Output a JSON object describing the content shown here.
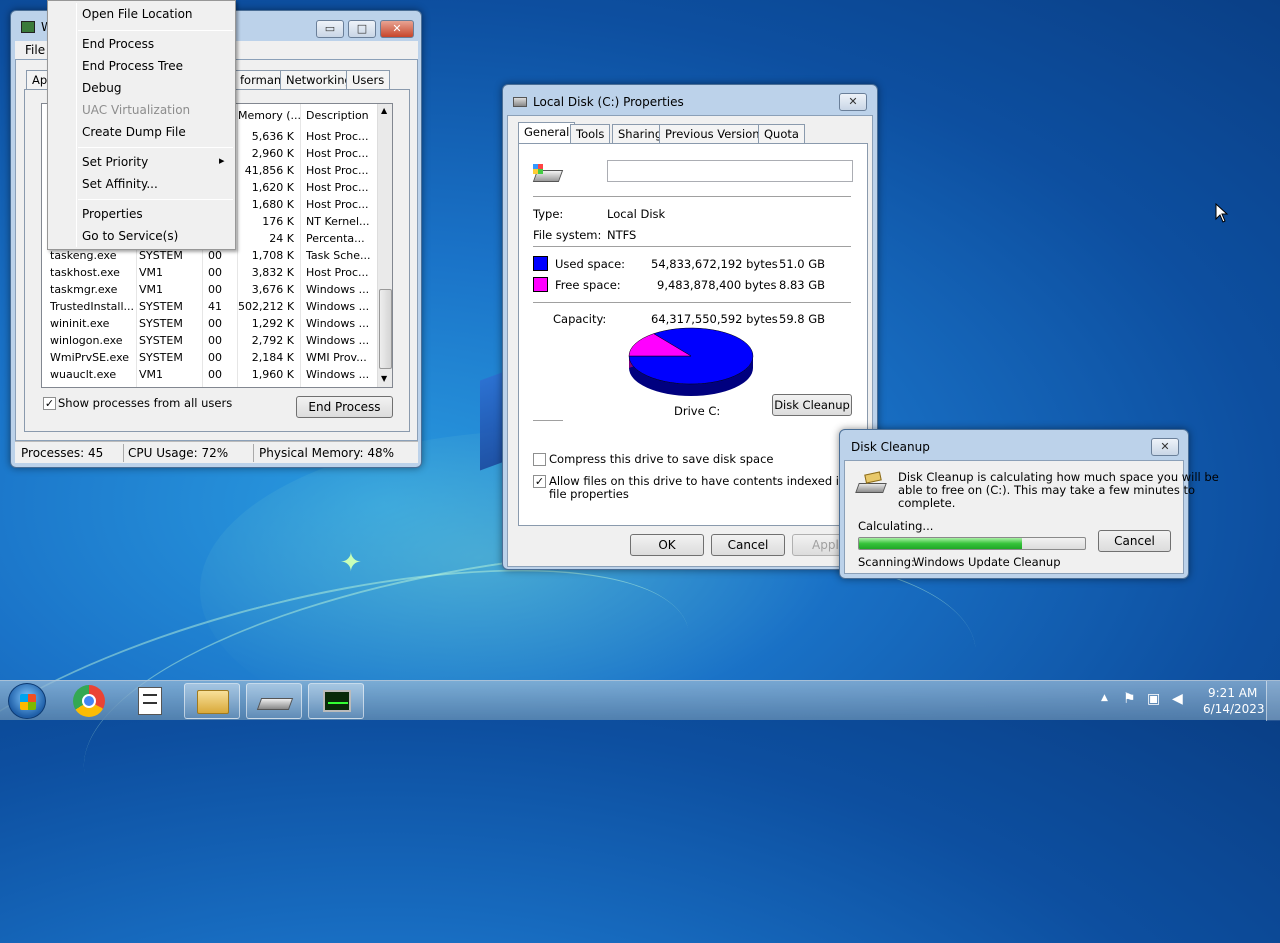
{
  "taskmgr": {
    "title": "W",
    "menu_file": "File",
    "tabs": [
      "App",
      "formance",
      "Networking",
      "Users"
    ],
    "columns": {
      "memory": "Memory (...",
      "description": "Description"
    },
    "rows": [
      {
        "name": "",
        "user": "",
        "cpu": "",
        "mem": "5,636 K",
        "desc": "Host Proc..."
      },
      {
        "name": "",
        "user": "",
        "cpu": "",
        "mem": "2,960 K",
        "desc": "Host Proc..."
      },
      {
        "name": "",
        "user": "",
        "cpu": "",
        "mem": "41,856 K",
        "desc": "Host Proc..."
      },
      {
        "name": "",
        "user": "",
        "cpu": "",
        "mem": "1,620 K",
        "desc": "Host Proc..."
      },
      {
        "name": "",
        "user": "",
        "cpu": "",
        "mem": "1,680 K",
        "desc": "Host Proc..."
      },
      {
        "name": "",
        "user": "",
        "cpu": "",
        "mem": "176 K",
        "desc": "NT Kernel..."
      },
      {
        "name": "",
        "user": "",
        "cpu": "",
        "mem": "24 K",
        "desc": "Percenta..."
      },
      {
        "name": "taskeng.exe",
        "user": "SYSTEM",
        "cpu": "00",
        "mem": "1,708 K",
        "desc": "Task Sche..."
      },
      {
        "name": "taskhost.exe",
        "user": "VM1",
        "cpu": "00",
        "mem": "3,832 K",
        "desc": "Host Proc..."
      },
      {
        "name": "taskmgr.exe",
        "user": "VM1",
        "cpu": "00",
        "mem": "3,676 K",
        "desc": "Windows ..."
      },
      {
        "name": "TrustedInstall...",
        "user": "SYSTEM",
        "cpu": "41",
        "mem": "502,212 K",
        "desc": "Windows ..."
      },
      {
        "name": "wininit.exe",
        "user": "SYSTEM",
        "cpu": "00",
        "mem": "1,292 K",
        "desc": "Windows ..."
      },
      {
        "name": "winlogon.exe",
        "user": "SYSTEM",
        "cpu": "00",
        "mem": "2,792 K",
        "desc": "Windows ..."
      },
      {
        "name": "WmiPrvSE.exe",
        "user": "SYSTEM",
        "cpu": "00",
        "mem": "2,184 K",
        "desc": "WMI Prov..."
      },
      {
        "name": "wuauclt.exe",
        "user": "VM1",
        "cpu": "00",
        "mem": "1,960 K",
        "desc": "Windows ..."
      }
    ],
    "show_all_label": "Show processes from all users",
    "show_all_checked": "✓",
    "end_process": "End Process",
    "status": {
      "processes": "Processes: 45",
      "cpu": "CPU Usage: 72%",
      "memory": "Physical Memory: 48%"
    }
  },
  "context_menu": {
    "open_location": "Open File Location",
    "end_process": "End Process",
    "end_tree": "End Process Tree",
    "debug": "Debug",
    "uac": "UAC Virtualization",
    "dump": "Create Dump File",
    "priority": "Set Priority",
    "affinity": "Set Affinity...",
    "properties": "Properties",
    "services": "Go to Service(s)",
    "submenu_arrow": "▸"
  },
  "props": {
    "title": "Local Disk (C:) Properties",
    "tabs": [
      "General",
      "Tools",
      "Sharing",
      "Previous Versions",
      "Quota"
    ],
    "name_value": "",
    "type_label": "Type:",
    "type_value": "Local Disk",
    "fs_label": "File system:",
    "fs_value": "NTFS",
    "used_label": "Used space:",
    "used_bytes": "54,833,672,192 bytes",
    "used_gb": "51.0 GB",
    "free_label": "Free space:",
    "free_bytes": "9,483,878,400 bytes",
    "free_gb": "8.83 GB",
    "cap_label": "Capacity:",
    "cap_bytes": "64,317,550,592 bytes",
    "cap_gb": "59.8 GB",
    "drive_label": "Drive C:",
    "cleanup_button": "Disk Cleanup",
    "compress_label": "Compress this drive to save disk space",
    "index_label_1": "Allow files on this drive to have contents indexed in addition to",
    "index_label_2": "file properties",
    "index_checked": "✓",
    "ok": "OK",
    "cancel": "Cancel",
    "apply": "Apply",
    "used_color": "#0000ff",
    "free_color": "#ff00ff",
    "used_fraction": 0.853
  },
  "cleanup": {
    "title": "Disk Cleanup",
    "message_1": "Disk Cleanup is calculating how much space you will be",
    "message_2": "able to free on  (C:). This may take a few minutes to",
    "message_3": "complete.",
    "calculating": "Calculating...",
    "progress": 0.72,
    "cancel": "Cancel",
    "scanning_label": "Scanning:",
    "scanning_value": "Windows Update Cleanup"
  },
  "taskbar": {
    "time": "9:21 AM",
    "date": "6/14/2023",
    "apps": [
      "start-orb",
      "chrome",
      "notepad",
      "explorer",
      "disk-cleanup",
      "task-manager"
    ]
  },
  "caption": {
    "minimize": "▭",
    "maximize": "□",
    "close": "✕"
  }
}
